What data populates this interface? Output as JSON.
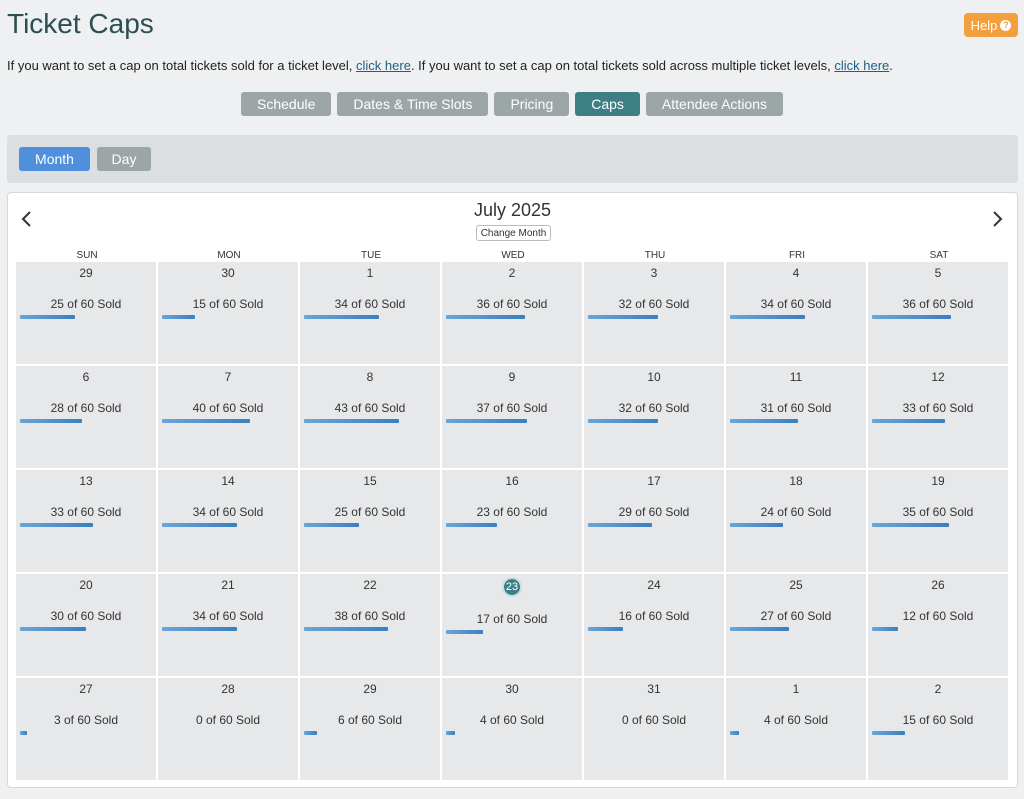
{
  "header": {
    "title": "Ticket Caps",
    "help_label": "Help",
    "help_icon": "?"
  },
  "intro": {
    "text1": "If you want to set a cap on total tickets sold for a ticket level, ",
    "link1": "click here",
    "text2": ". If you want to set a cap on total tickets sold across multiple ticket levels, ",
    "link2": "click here",
    "text3": "."
  },
  "tabs": [
    {
      "label": "Schedule"
    },
    {
      "label": "Dates & Time Slots"
    },
    {
      "label": "Pricing"
    },
    {
      "label": "Caps",
      "active": true
    },
    {
      "label": "Attendee Actions"
    }
  ],
  "views": {
    "month": "Month",
    "day": "Day",
    "active": "month"
  },
  "calendar": {
    "prev_icon": "‹",
    "next_icon": "›",
    "month_title": "July 2025",
    "change_month": "Change Month",
    "days_of_week": [
      "SUN",
      "MON",
      "TUE",
      "WED",
      "THU",
      "FRI",
      "SAT"
    ],
    "cap": 60,
    "cells": [
      {
        "date": "29",
        "sold": "25 of 60 Sold",
        "n": 25
      },
      {
        "date": "30",
        "sold": "15 of 60 Sold",
        "n": 15
      },
      {
        "date": "1",
        "sold": "34 of 60 Sold",
        "n": 34
      },
      {
        "date": "2",
        "sold": "36 of 60 Sold",
        "n": 36
      },
      {
        "date": "3",
        "sold": "32 of 60 Sold",
        "n": 32
      },
      {
        "date": "4",
        "sold": "34 of 60 Sold",
        "n": 34
      },
      {
        "date": "5",
        "sold": "36 of 60 Sold",
        "n": 36
      },
      {
        "date": "6",
        "sold": "28 of 60 Sold",
        "n": 28
      },
      {
        "date": "7",
        "sold": "40 of 60 Sold",
        "n": 40
      },
      {
        "date": "8",
        "sold": "43 of 60 Sold",
        "n": 43
      },
      {
        "date": "9",
        "sold": "37 of 60 Sold",
        "n": 37
      },
      {
        "date": "10",
        "sold": "32 of 60 Sold",
        "n": 32
      },
      {
        "date": "11",
        "sold": "31 of 60 Sold",
        "n": 31
      },
      {
        "date": "12",
        "sold": "33 of 60 Sold",
        "n": 33
      },
      {
        "date": "13",
        "sold": "33 of 60 Sold",
        "n": 33
      },
      {
        "date": "14",
        "sold": "34 of 60 Sold",
        "n": 34
      },
      {
        "date": "15",
        "sold": "25 of 60 Sold",
        "n": 25
      },
      {
        "date": "16",
        "sold": "23 of 60 Sold",
        "n": 23
      },
      {
        "date": "17",
        "sold": "29 of 60 Sold",
        "n": 29
      },
      {
        "date": "18",
        "sold": "24 of 60 Sold",
        "n": 24
      },
      {
        "date": "19",
        "sold": "35 of 60 Sold",
        "n": 35
      },
      {
        "date": "20",
        "sold": "30 of 60 Sold",
        "n": 30
      },
      {
        "date": "21",
        "sold": "34 of 60 Sold",
        "n": 34
      },
      {
        "date": "22",
        "sold": "38 of 60 Sold",
        "n": 38
      },
      {
        "date": "23",
        "sold": "17 of 60 Sold",
        "n": 17,
        "today": true
      },
      {
        "date": "24",
        "sold": "16 of 60 Sold",
        "n": 16
      },
      {
        "date": "25",
        "sold": "27 of 60 Sold",
        "n": 27
      },
      {
        "date": "26",
        "sold": "12 of 60 Sold",
        "n": 12
      },
      {
        "date": "27",
        "sold": "3 of 60 Sold",
        "n": 3
      },
      {
        "date": "28",
        "sold": "0 of 60 Sold",
        "n": 0
      },
      {
        "date": "29",
        "sold": "6 of 60 Sold",
        "n": 6
      },
      {
        "date": "30",
        "sold": "4 of 60 Sold",
        "n": 4
      },
      {
        "date": "31",
        "sold": "0 of 60 Sold",
        "n": 0
      },
      {
        "date": "1",
        "sold": "4 of 60 Sold",
        "n": 4
      },
      {
        "date": "2",
        "sold": "15 of 60 Sold",
        "n": 15
      }
    ]
  },
  "colors": {
    "accent": "#3d7f84",
    "help": "#f2a03d",
    "month_btn": "#4f8fdc",
    "tab": "#9ca6a7"
  }
}
